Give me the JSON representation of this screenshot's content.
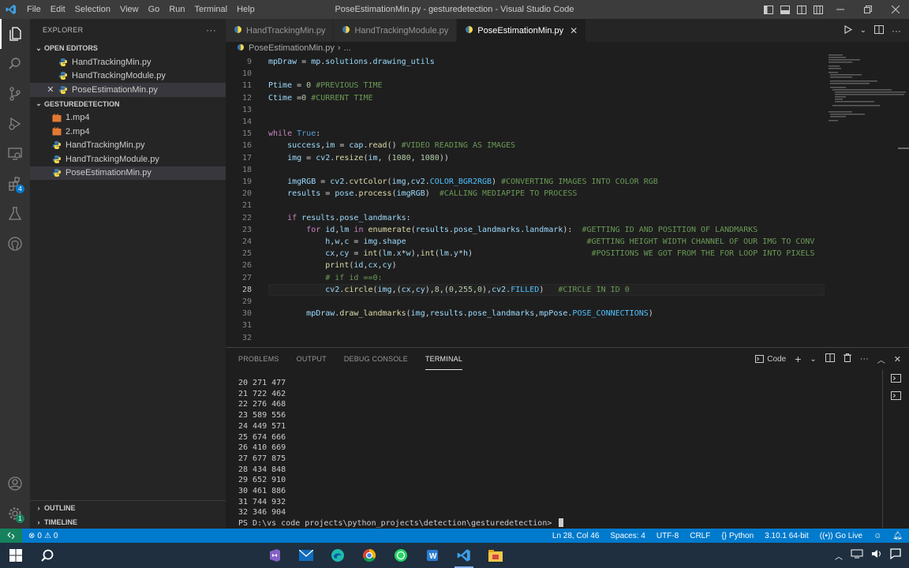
{
  "titlebar": {
    "menu": [
      "File",
      "Edit",
      "Selection",
      "View",
      "Go",
      "Run",
      "Terminal",
      "Help"
    ],
    "title": "PoseEstimationMin.py - gesturedetection - Visual Studio Code"
  },
  "sidebar": {
    "header": "EXPLORER",
    "open_editors_label": "OPEN EDITORS",
    "open_editors": [
      "HandTrackingMin.py",
      "HandTrackingModule.py",
      "PoseEstimationMin.py"
    ],
    "folder_label": "GESTUREDETECTION",
    "files": [
      "1.mp4",
      "2.mp4",
      "HandTrackingMin.py",
      "HandTrackingModule.py",
      "PoseEstimationMin.py"
    ],
    "outline_label": "OUTLINE",
    "timeline_label": "TIMELINE",
    "extensions_badge": "4"
  },
  "tabs": [
    "HandTrackingMin.py",
    "HandTrackingModule.py",
    "PoseEstimationMin.py"
  ],
  "breadcrumb": {
    "file": "PoseEstimationMin.py",
    "rest": "..."
  },
  "editor": {
    "current_line": 28,
    "lines": [
      {
        "n": "9",
        "text": "mpDraw = mp.solutions.drawing_utils"
      },
      {
        "n": "10",
        "text": ""
      },
      {
        "n": "11",
        "text": "Ptime = 0 #PREVIOUS TIME"
      },
      {
        "n": "12",
        "text": "Ctime =0 #CURRENT TIME"
      },
      {
        "n": "13",
        "text": ""
      },
      {
        "n": "14",
        "text": ""
      },
      {
        "n": "15",
        "text": "while True:"
      },
      {
        "n": "16",
        "text": "    success,im = cap.read() #VIDEO READING AS IMAGES"
      },
      {
        "n": "17",
        "text": "    img = cv2.resize(im, (1080, 1080))"
      },
      {
        "n": "18",
        "text": ""
      },
      {
        "n": "19",
        "text": "    imgRGB = cv2.cvtColor(img,cv2.COLOR_BGR2RGB) #CONVERTING IMAGES INTO COLOR RGB"
      },
      {
        "n": "20",
        "text": "    results = pose.process(imgRGB)  #CALLING MEDIAPIPE TO PROCESS"
      },
      {
        "n": "21",
        "text": ""
      },
      {
        "n": "22",
        "text": "    if results.pose_landmarks:"
      },
      {
        "n": "23",
        "text": "        for id,lm in enumerate(results.pose_landmarks.landmark):  #GETTING ID AND POSITION OF LANDMARKS"
      },
      {
        "n": "24",
        "text": "            h,w,c = img.shape                                      #GETTING HEIGHT WIDTH CHANNEL OF OUR IMG TO CONV"
      },
      {
        "n": "25",
        "text": "            cx,cy = int(lm.x*w),int(lm.y*h)                         #POSITIONS WE GOT FROM THE FOR LOOP INTO PIXELS"
      },
      {
        "n": "26",
        "text": "            print(id,cx,cy)"
      },
      {
        "n": "27",
        "text": "            # if id ==0:"
      },
      {
        "n": "28",
        "text": "            cv2.circle(img,(cx,cy),8,(0,255,0),cv2.FILLED)   #CIRCLE IN ID 0"
      },
      {
        "n": "29",
        "text": ""
      },
      {
        "n": "30",
        "text": "        mpDraw.draw_landmarks(img,results.pose_landmarks,mpPose.POSE_CONNECTIONS)"
      },
      {
        "n": "31",
        "text": ""
      },
      {
        "n": "32",
        "text": ""
      }
    ]
  },
  "panel": {
    "tabs": [
      "PROBLEMS",
      "OUTPUT",
      "DEBUG CONSOLE",
      "TERMINAL"
    ],
    "active_tab": "TERMINAL",
    "shell_label": "Code",
    "terminal_lines": [
      "20 271 477",
      "21 722 462",
      "22 276 468",
      "23 589 556",
      "24 449 571",
      "25 674 666",
      "26 410 669",
      "27 677 875",
      "28 434 848",
      "29 652 910",
      "30 461 886",
      "31 744 932",
      "32 346 904"
    ],
    "prompt": "PS D:\\vs code projects\\python_projects\\detection\\gesturedetection> "
  },
  "statusbar": {
    "errors": "0",
    "warnings": "0",
    "position": "Ln 28, Col 46",
    "spaces": "Spaces: 4",
    "encoding": "UTF-8",
    "eol": "CRLF",
    "language": "Python",
    "interpreter": "3.10.1 64-bit",
    "golive": "Go Live"
  },
  "colors": {
    "accent": "#007acc",
    "remote": "#16825d",
    "sidebar": "#252526",
    "editor": "#1e1e1e",
    "activitybar": "#333333"
  }
}
